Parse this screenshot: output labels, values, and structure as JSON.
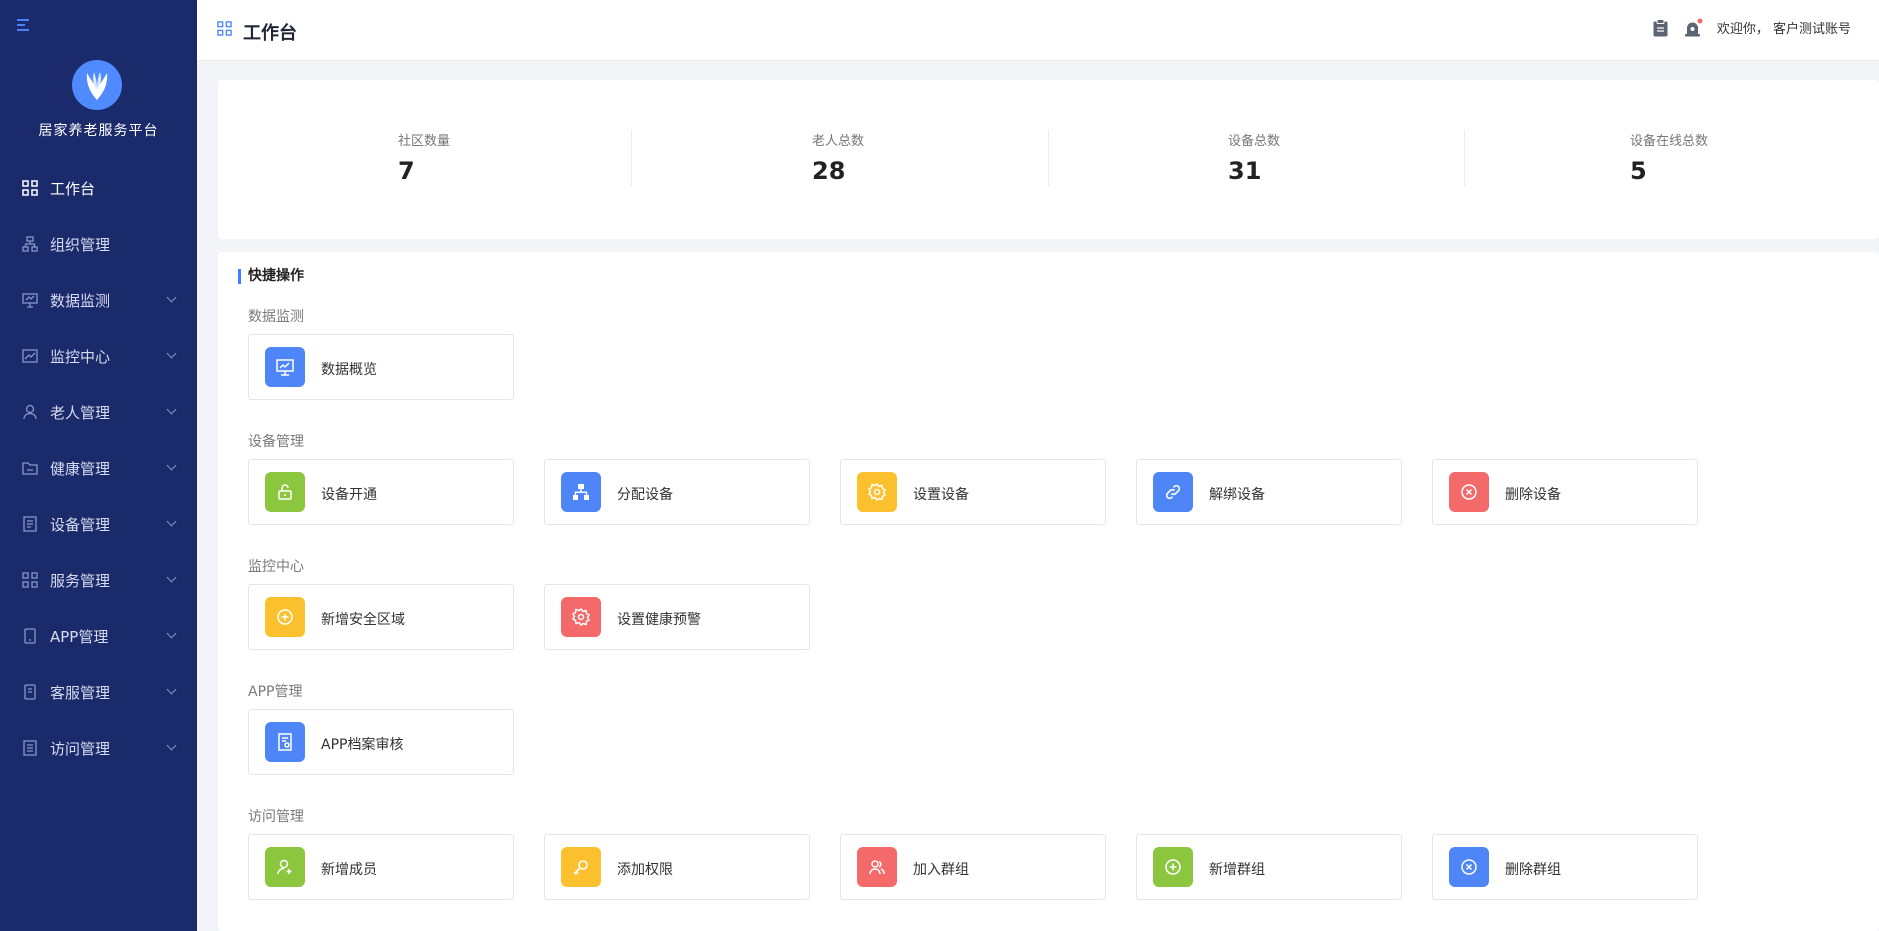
{
  "sidebar": {
    "brand": "居家养老服务平台",
    "items": [
      {
        "label": "工作台"
      },
      {
        "label": "组织管理"
      },
      {
        "label": "数据监测"
      },
      {
        "label": "监控中心"
      },
      {
        "label": "老人管理"
      },
      {
        "label": "健康管理"
      },
      {
        "label": "设备管理"
      },
      {
        "label": "服务管理"
      },
      {
        "label": "APP管理"
      },
      {
        "label": "客服管理"
      },
      {
        "label": "访问管理"
      }
    ]
  },
  "header": {
    "title": "工作台",
    "welcome": "欢迎你， 客户测试账号"
  },
  "stats": [
    {
      "label": "社区数量",
      "value": "7"
    },
    {
      "label": "老人总数",
      "value": "28"
    },
    {
      "label": "设备总数",
      "value": "31"
    },
    {
      "label": "设备在线总数",
      "value": "5"
    }
  ],
  "quick": {
    "title": "快捷操作",
    "groups": [
      {
        "title": "数据监测",
        "items": [
          {
            "label": "数据概览",
            "icon": "monitor-icon",
            "color": "#4f86f7"
          }
        ]
      },
      {
        "title": "设备管理",
        "items": [
          {
            "label": "设备开通",
            "icon": "unlock-icon",
            "color": "#8cc63f"
          },
          {
            "label": "分配设备",
            "icon": "sitemap-icon",
            "color": "#4f86f7"
          },
          {
            "label": "设置设备",
            "icon": "gear-icon",
            "color": "#fbc02d"
          },
          {
            "label": "解绑设备",
            "icon": "link-icon",
            "color": "#4f86f7"
          },
          {
            "label": "删除设备",
            "icon": "close-circle-icon",
            "color": "#f46a6a"
          }
        ]
      },
      {
        "title": "监控中心",
        "items": [
          {
            "label": "新增安全区域",
            "icon": "plus-circle-icon",
            "color": "#fbc02d"
          },
          {
            "label": "设置健康预警",
            "icon": "gear-icon",
            "color": "#f46a6a"
          }
        ]
      },
      {
        "title": "APP管理",
        "items": [
          {
            "label": "APP档案审核",
            "icon": "document-icon",
            "color": "#4f86f7"
          }
        ]
      },
      {
        "title": "访问管理",
        "items": [
          {
            "label": "新增成员",
            "icon": "user-add-icon",
            "color": "#8cc63f"
          },
          {
            "label": "添加权限",
            "icon": "key-icon",
            "color": "#fbc02d"
          },
          {
            "label": "加入群组",
            "icon": "users-icon",
            "color": "#f46a6a"
          },
          {
            "label": "新增群组",
            "icon": "plus-circle-icon",
            "color": "#8cc63f"
          },
          {
            "label": "删除群组",
            "icon": "close-circle-icon",
            "color": "#4f86f7"
          }
        ]
      }
    ]
  }
}
